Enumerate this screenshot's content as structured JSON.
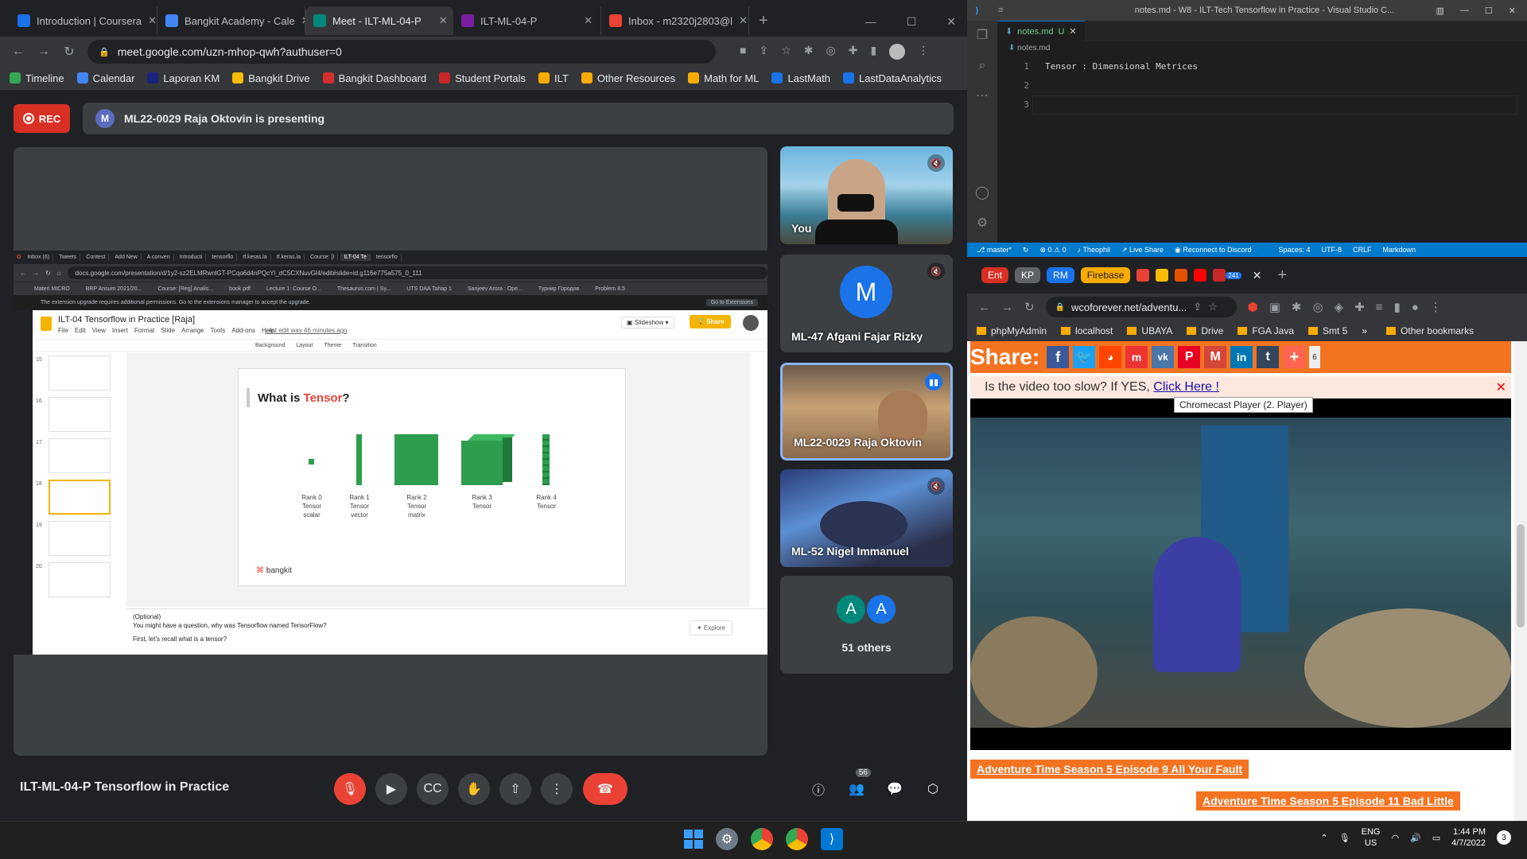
{
  "left_browser": {
    "tabs": [
      {
        "title": "Introduction | Coursera",
        "color": "#1a73e8"
      },
      {
        "title": "Bangkit Academy - Cale",
        "color": "#4285f4"
      },
      {
        "title": "Meet - ILT-ML-04-P",
        "color": "#00897b"
      },
      {
        "title": "ILT-ML-04-P",
        "color": "#7b1fa2"
      },
      {
        "title": "Inbox - m2320j2803@l",
        "color": "#ea4335"
      }
    ],
    "url": "meet.google.com/uzn-mhop-qwh?authuser=0",
    "bookmarks": [
      {
        "label": "Timeline",
        "color": "#34a853"
      },
      {
        "label": "Calendar",
        "color": "#4285f4"
      },
      {
        "label": "Laporan KM",
        "color": "#1a237e"
      },
      {
        "label": "Bangkit Drive",
        "color": "#fbbc04"
      },
      {
        "label": "Bangkit Dashboard",
        "color": "#d32f2f"
      },
      {
        "label": "Student Portals",
        "color": "#c62828"
      },
      {
        "label": "ILT",
        "color": "#f9ab00"
      },
      {
        "label": "Other Resources",
        "color": "#f9ab00"
      },
      {
        "label": "Math for ML",
        "color": "#f9ab00"
      },
      {
        "label": "LastMath",
        "color": "#1a73e8"
      },
      {
        "label": "LastDataAnalytics",
        "color": "#1a73e8"
      }
    ]
  },
  "meet": {
    "rec_label": "REC",
    "presenter_initial": "M",
    "presenter_text": "ML22-0029 Raja Oktovin is presenting",
    "meeting_title": "ILT-ML-04-P Tensorflow in Practice",
    "participants_count": "56",
    "tiles": [
      {
        "name": "You"
      },
      {
        "name": "ML-47 Afgani Fajar Rizky",
        "initial": "M"
      },
      {
        "name": "ML22-0029 Raja Oktovin"
      },
      {
        "name": "ML-52 Nigel Immanuel"
      },
      {
        "name": "51 others",
        "initials": [
          "A",
          "A"
        ]
      }
    ]
  },
  "slides": {
    "doc_title": "ILT-04 Tensorflow in Practice [Raja]",
    "url": "docs.google.com/presentation/d/1y2-sz2ELMRwnlGT-PCqo6d4nPQcYl_dC5CXNuvGl4/edit#slide=id.g116e775a575_0_111",
    "menu": [
      "File",
      "Edit",
      "View",
      "Insert",
      "Format",
      "Slide",
      "Arrange",
      "Tools",
      "Add-ons",
      "Help"
    ],
    "last_edit": "Last edit was 46 minutes ago",
    "slideshow": "Slideshow",
    "share": "Share",
    "toolbar_items": [
      "Background",
      "Layout",
      "Theme",
      "Transition"
    ],
    "notice": "The extension upgrade requires additional permissions. Go to the extensions manager to accept the upgrade.",
    "notice_btn": "Go to Extensions",
    "slide_numbers": [
      "15",
      "16",
      "17",
      "18",
      "19",
      "20"
    ],
    "slide_title_a": "What is ",
    "slide_title_b": "Tensor",
    "slide_title_c": "?",
    "ranks": [
      {
        "l1": "Rank 0",
        "l2": "Tensor",
        "l3": "scalar"
      },
      {
        "l1": "Rank 1",
        "l2": "Tensor",
        "l3": "vector"
      },
      {
        "l1": "Rank 2",
        "l2": "Tensor",
        "l3": "matrix"
      },
      {
        "l1": "Rank 3",
        "l2": "Tensor",
        "l3": ""
      },
      {
        "l1": "Rank 4",
        "l2": "Tensor",
        "l3": ""
      }
    ],
    "brand": "bangkit",
    "notes_1": "(Optional)",
    "notes_2": "You might have a question, why was Tensorflow named TensorFlow?",
    "notes_3": "First, let's recall what is a tensor?",
    "explore": "Explore"
  },
  "vscode": {
    "title": "notes.md - W8 - ILT-Tech Tensorflow in Practice - Visual Studio C...",
    "tab": "notes.md",
    "tab_status": "U",
    "breadcrumb": "notes.md",
    "lines": [
      "Tensor : Dimensional Metrices",
      "",
      ""
    ],
    "line_numbers": [
      "1",
      "2",
      "3"
    ],
    "status": {
      "branch": "master*",
      "errors": "0",
      "warnings": "0",
      "user": "Theophil",
      "liveshare": "Live Share",
      "discord": "Reconnect to Discord",
      "spaces": "Spaces: 4",
      "encoding": "UTF-8",
      "eol": "CRLF",
      "lang": "Markdown"
    }
  },
  "right_browser": {
    "tabs": [
      "Ent",
      "KP",
      "RM",
      "Firebase"
    ],
    "badge": "241",
    "url": "wcoforever.net/adventu...",
    "bookmarks": [
      "phpMyAdmin",
      "localhost",
      "UBAYA",
      "Drive",
      "FGA Java",
      "Smt 5",
      "Other bookmarks"
    ],
    "share_label": "Share:",
    "share_count": "6",
    "slow_text": "Is the video too slow? If YES,",
    "slow_link": "Click Here !",
    "tooltip": "Chromecast Player (2. Player)",
    "episode_links": [
      "Adventure Time Season 5 Episode 9 All Your Fault",
      "Adventure Time Season 5 Episode 11 Bad Little"
    ]
  },
  "taskbar": {
    "lang1": "ENG",
    "lang2": "US",
    "time": "1:44 PM",
    "date": "4/7/2022",
    "notif": "3"
  }
}
